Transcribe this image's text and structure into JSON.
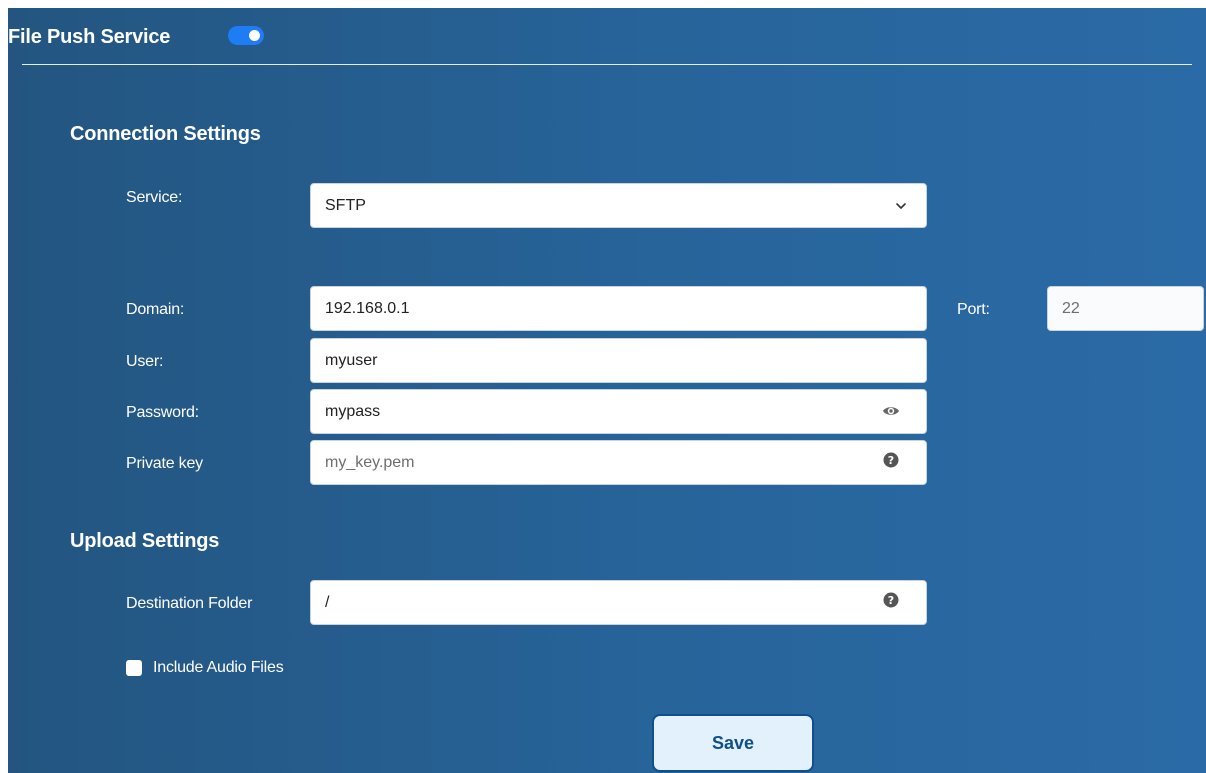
{
  "header": {
    "title": "File Push Service",
    "service_enabled": true
  },
  "connection": {
    "title": "Connection Settings",
    "service": {
      "label": "Service:",
      "value": "SFTP"
    },
    "domain": {
      "label": "Domain:",
      "value": "192.168.0.1"
    },
    "port": {
      "label": "Port:",
      "value": "22"
    },
    "user": {
      "label": "User:",
      "value": "myuser"
    },
    "password": {
      "label": "Password:",
      "value": "mypass"
    },
    "private_key": {
      "label": "Private key",
      "placeholder": "my_key.pem"
    }
  },
  "upload": {
    "title": "Upload Settings",
    "destination": {
      "label": "Destination Folder",
      "value": "/"
    },
    "include_audio": {
      "label": "Include Audio Files",
      "checked": false
    }
  },
  "actions": {
    "save_label": "Save"
  },
  "colors": {
    "panel_bg": "#2a63a0",
    "toggle_on": "#1e7cf5",
    "save_bg": "#e2f1fc",
    "save_text": "#0f4f8a"
  },
  "icons": {
    "dropdown": "chevron-down-icon",
    "password_toggle": "eye-icon",
    "private_key_help": "question-circle-icon",
    "destination_help": "question-circle-icon"
  }
}
